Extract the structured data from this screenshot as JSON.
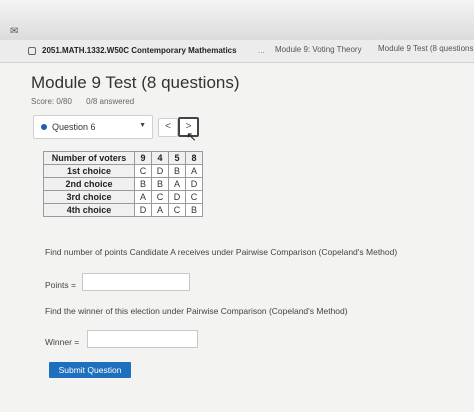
{
  "breadcrumb": {
    "course": "2051.MATH.1332.W50C Contemporary Mathematics",
    "separator": "...",
    "module": "Module 9: Voting Theory",
    "current": "Module 9 Test (8 questions)"
  },
  "test": {
    "title": "Module 9 Test (8 questions)",
    "score": "Score: 0/80",
    "answered": "0/8 answered"
  },
  "question_nav": {
    "selected": "Question 6",
    "prev_label": "<",
    "next_label": ">"
  },
  "table": {
    "header_label": "Number of voters",
    "voters": [
      "9",
      "4",
      "5",
      "8"
    ],
    "rows": [
      {
        "label": "1st choice",
        "cells": [
          "C",
          "D",
          "B",
          "A"
        ]
      },
      {
        "label": "2nd choice",
        "cells": [
          "B",
          "B",
          "A",
          "D"
        ]
      },
      {
        "label": "3rd choice",
        "cells": [
          "A",
          "C",
          "D",
          "C"
        ]
      },
      {
        "label": "4th choice",
        "cells": [
          "D",
          "A",
          "C",
          "B"
        ]
      }
    ]
  },
  "q1": {
    "prompt": "Find number of points Candidate A receives under Pairwise Comparison (Copeland's Method)",
    "label": "Points ="
  },
  "q2": {
    "prompt": "Find the winner of this election under Pairwise Comparison (Copeland's Method)",
    "label": "Winner ="
  },
  "submit_label": "Submit Question",
  "colors": {
    "accent": "#1f6fbf",
    "dot": "#1f5fa8"
  },
  "icons": {
    "corner": "ribbon-icon",
    "course": "course-square-icon",
    "dropdown": "caret-down-icon",
    "cursor": "mouse-cursor-icon"
  }
}
